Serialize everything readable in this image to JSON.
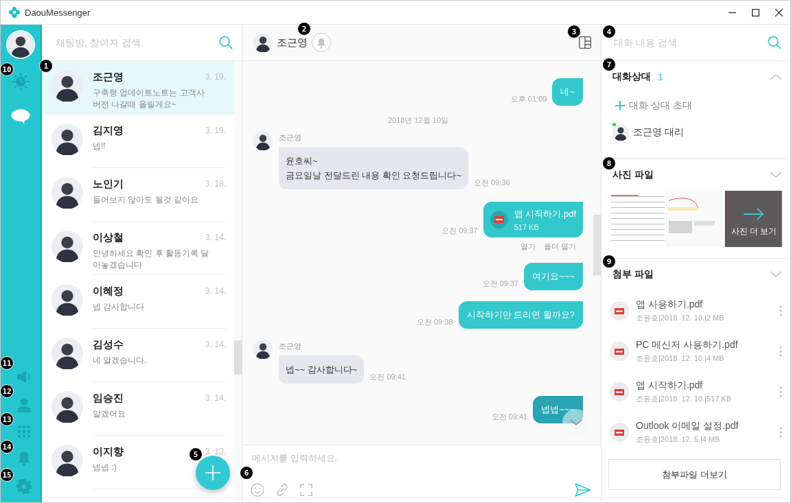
{
  "window": {
    "title": "DaouMessenger"
  },
  "rail": {
    "items": [
      {
        "kind": "recent",
        "selected": false
      },
      {
        "kind": "chat",
        "selected": true
      },
      {
        "kind": "notice",
        "selected": false
      },
      {
        "kind": "contacts",
        "selected": false
      },
      {
        "kind": "apps",
        "selected": false
      },
      {
        "kind": "alerts",
        "selected": false
      },
      {
        "kind": "settings",
        "selected": false
      }
    ]
  },
  "chat_list": {
    "search": {
      "placeholder": "채팅방, 참여자 검색"
    },
    "chats": [
      {
        "name": "조근영",
        "date": "3. 19.",
        "preview": "구축형 업데이트노트는 고객사 버전 나갈때 올릴게요~",
        "selected": true
      },
      {
        "name": "김지영",
        "date": "3. 19.",
        "preview": "넵!!",
        "selected": false
      },
      {
        "name": "노인기",
        "date": "3. 18.",
        "preview": "들어보지 않아도 될것 같아요",
        "selected": false
      },
      {
        "name": "이상철",
        "date": "3. 14.",
        "preview": "안녕하세요 확인 후 활동기록 달아놓겠습니다",
        "selected": false
      },
      {
        "name": "이혜정",
        "date": "3. 14.",
        "preview": "넵 감사합니다",
        "selected": false
      },
      {
        "name": "김성수",
        "date": "3. 14.",
        "preview": "네 알겠습니다.",
        "selected": false
      },
      {
        "name": "임승진",
        "date": "3. 14.",
        "preview": "알겠어요",
        "selected": false
      },
      {
        "name": "이지향",
        "date": "3. 13.",
        "preview": "넵넵 :)",
        "selected": false
      }
    ]
  },
  "chat": {
    "name": "조근영",
    "messages": [
      {
        "kind": "sent",
        "text": "네~",
        "time": "오후 01:09",
        "highlighted": false
      },
      {
        "kind": "date",
        "text": "2018년 12월 10일"
      },
      {
        "kind": "received",
        "sender": "조근영",
        "text": "윤호씨~\n금요일날 전달드린 내용 확인 요청드립니다~",
        "time": "오전 09:36"
      },
      {
        "kind": "file",
        "name": "앱 시작하기.pdf",
        "size": "517 KB",
        "time": "오전 09:37",
        "actions": [
          "열기",
          "폴더 열기"
        ]
      },
      {
        "kind": "sent",
        "text": "여기요~~~",
        "time": "오전 09:37",
        "highlighted": false
      },
      {
        "kind": "sent",
        "text": "시작하기만 드리면 될까요?",
        "time": "오전 09:38",
        "highlighted": false
      },
      {
        "kind": "received",
        "sender": "조근영",
        "text": "넵~~ 감사합니다~",
        "time": "오전 09:41"
      },
      {
        "kind": "sent",
        "text": "넵넵~~~",
        "time": "오전 09:41",
        "highlighted": true
      }
    ],
    "composer": {
      "placeholder": "메시지를 입력하세요."
    }
  },
  "info_panel": {
    "search": {
      "placeholder": "대화 내용 검색"
    },
    "participants": {
      "title": "대화상대",
      "count": "1",
      "expanded": true,
      "invite": "대화 상대 초대",
      "members": [
        {
          "name": "조근영 대리",
          "online": true
        }
      ]
    },
    "photos": {
      "title": "사진 파일",
      "expanded": false,
      "more": "사진 더 보기"
    },
    "attachments": {
      "title": "첨부 파일",
      "expanded": false,
      "files": [
        {
          "name": "앱 사용하기.pdf",
          "meta": "조윤호|2018. 12. 10.|2 MB"
        },
        {
          "name": "PC 메신저 사용하기.pdf",
          "meta": "조윤호|2018. 12. 10.|4 MB"
        },
        {
          "name": "앱 시작하기.pdf",
          "meta": "조윤호|2018. 12. 10.|517 KB"
        },
        {
          "name": "Outlook 이메일 설정.pdf",
          "meta": "조윤호|2018. 12. 5.|4 MB"
        }
      ],
      "more": "첨부파일 더보기"
    }
  },
  "callouts": [
    "1",
    "2",
    "3",
    "4",
    "5",
    "6",
    "7",
    "8",
    "9",
    "10",
    "11",
    "12",
    "13",
    "14",
    "15"
  ]
}
